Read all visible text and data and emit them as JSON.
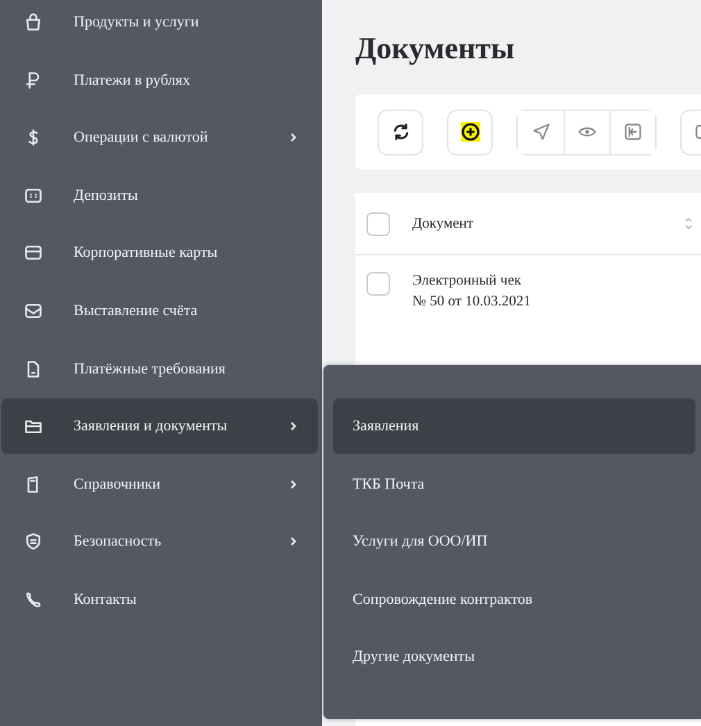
{
  "sidebar": {
    "items": [
      {
        "label": "Продукты и услуги",
        "has_submenu": false,
        "selected": false
      },
      {
        "label": "Платежи в рублях",
        "has_submenu": false,
        "selected": false
      },
      {
        "label": "Операции с валютой",
        "has_submenu": true,
        "selected": false
      },
      {
        "label": "Депозиты",
        "has_submenu": false,
        "selected": false
      },
      {
        "label": "Корпоративные карты",
        "has_submenu": false,
        "selected": false
      },
      {
        "label": "Выставление счёта",
        "has_submenu": false,
        "selected": false
      },
      {
        "label": "Платёжные требования",
        "has_submenu": false,
        "selected": false
      },
      {
        "label": "Заявления и документы",
        "has_submenu": true,
        "selected": true
      },
      {
        "label": "Справочники",
        "has_submenu": true,
        "selected": false
      },
      {
        "label": "Безопасность",
        "has_submenu": true,
        "selected": false
      },
      {
        "label": "Контакты",
        "has_submenu": false,
        "selected": false
      }
    ]
  },
  "page": {
    "title": "Документы"
  },
  "table": {
    "header": {
      "checked": false,
      "column": "Документ"
    },
    "rows": [
      {
        "checked": false,
        "lines": [
          "Электронный чек",
          "№ 50 от 10.03.2021"
        ]
      }
    ]
  },
  "submenu": {
    "items": [
      {
        "label": "Заявления",
        "selected": true
      },
      {
        "label": "ТКБ Почта",
        "selected": false
      },
      {
        "label": "Услуги для ООО/ИП",
        "selected": false
      },
      {
        "label": "Сопровождение контрактов",
        "selected": false
      },
      {
        "label": "Другие документы",
        "selected": false
      }
    ]
  }
}
